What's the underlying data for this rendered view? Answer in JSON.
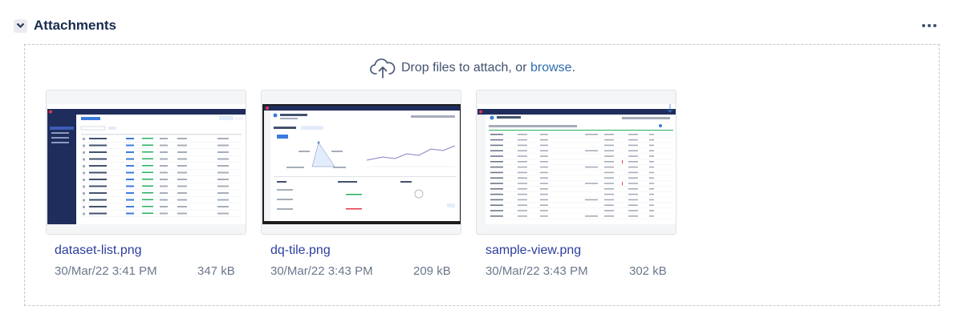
{
  "section": {
    "title": "Attachments",
    "toggle_icon": "chevron-down-icon",
    "more_icon": "more-horizontal-icon"
  },
  "dropzone": {
    "icon": "cloud-upload-icon",
    "prefix": "Drop files to attach, or ",
    "browse_link": "browse",
    "suffix": "."
  },
  "attachments": [
    {
      "name": "dataset-list.png",
      "date": "30/Mar/22 3:41 PM",
      "size": "347 kB"
    },
    {
      "name": "dq-tile.png",
      "date": "30/Mar/22 3:43 PM",
      "size": "209 kB"
    },
    {
      "name": "sample-view.png",
      "date": "30/Mar/22 3:43 PM",
      "size": "302 kB"
    }
  ],
  "colors": {
    "link": "#2f6dad",
    "filename": "#2c3e9e",
    "meta": "#6b778c",
    "brand_red": "#e5344a",
    "sidebar_navy": "#1f2d5c"
  }
}
